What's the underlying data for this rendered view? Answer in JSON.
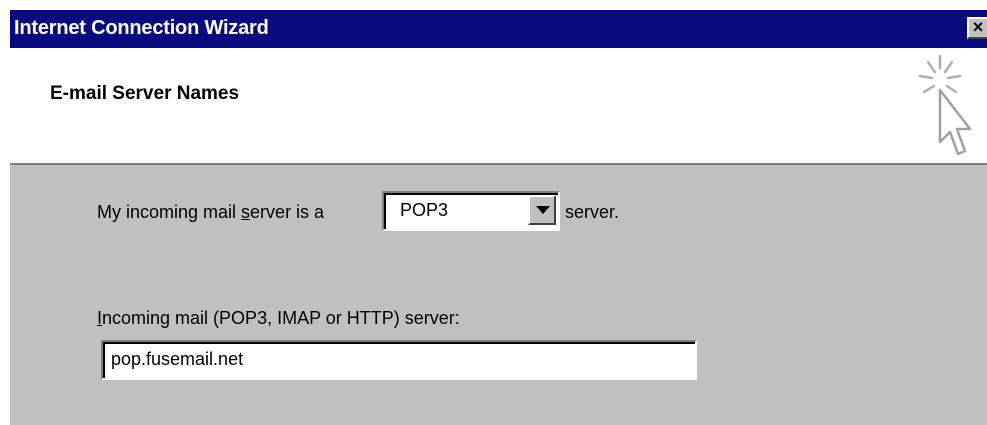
{
  "window": {
    "title": "Internet Connection Wizard",
    "close_glyph": "×"
  },
  "header": {
    "title": "E-mail Server Names",
    "icon": "wizard-sparkle-cursor-icon"
  },
  "incoming_type": {
    "label_prefix": "My incoming mail ",
    "label_mnemonic": "s",
    "label_suffix": "erver is a",
    "selected_value": "POP3",
    "trailing_text": "server."
  },
  "incoming_server": {
    "label_mnemonic": "I",
    "label_rest": "ncoming mail (POP3, IMAP or HTTP) server:",
    "value": "pop.fusemail.net"
  },
  "colors": {
    "titlebar": "#0a0a80",
    "dialog_face": "#c0c0c0",
    "header_background": "#ffffff"
  }
}
